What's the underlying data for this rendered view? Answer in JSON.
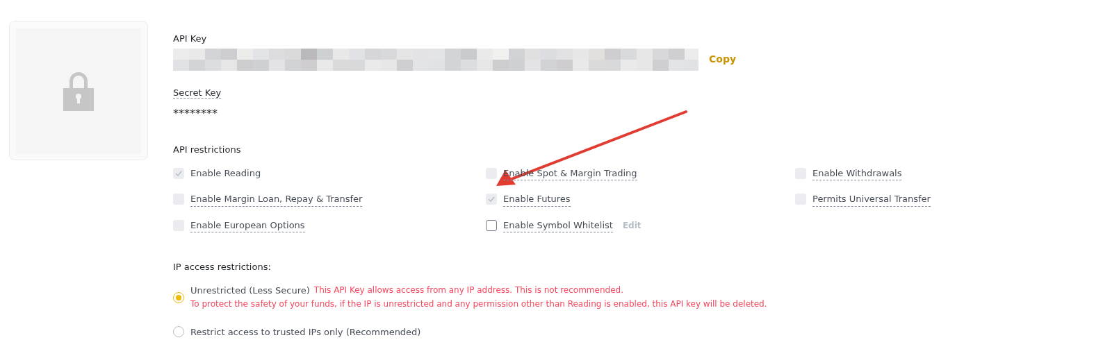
{
  "api_key": {
    "label": "API Key",
    "copy": "Copy"
  },
  "secret_key": {
    "label": "Secret Key",
    "value": "********"
  },
  "api_restrictions": {
    "title": "API restrictions",
    "options": [
      {
        "label": "Enable Reading",
        "checked": true,
        "disabled": true
      },
      {
        "label": "Enable Spot & Margin Trading",
        "checked": false,
        "disabled": true
      },
      {
        "label": "Enable Withdrawals",
        "checked": false,
        "disabled": true
      },
      {
        "label": "Enable Margin Loan, Repay & Transfer",
        "checked": false,
        "disabled": true
      },
      {
        "label": "Enable Futures",
        "checked": true,
        "disabled": true
      },
      {
        "label": "Permits Universal Transfer",
        "checked": false,
        "disabled": true
      },
      {
        "label": "Enable European Options",
        "checked": false,
        "disabled": true
      },
      {
        "label": "Enable Symbol Whitelist",
        "checked": false,
        "disabled": false,
        "action": "Edit"
      }
    ]
  },
  "ip_restrictions": {
    "title": "IP access restrictions:",
    "options": [
      {
        "label": "Unrestricted (Less Secure)",
        "selected": true,
        "warning": "This API Key allows access from any IP address. This is not recommended.",
        "warning_2": "To protect the safety of your funds, if the IP is unrestricted and any permission other than Reading is enabled, this API key will be deleted."
      },
      {
        "label": "Restrict access to trusted IPs only (Recommended)",
        "selected": false
      }
    ]
  }
}
